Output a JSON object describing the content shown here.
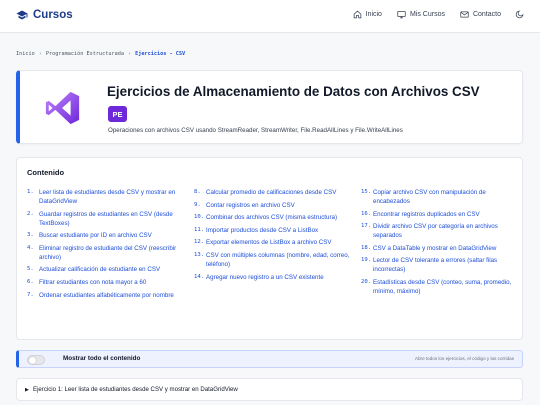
{
  "header": {
    "brand": "Cursos",
    "nav": [
      {
        "label": "Inicio",
        "icon": "home-icon"
      },
      {
        "label": "Mis Cursos",
        "icon": "monitor-icon"
      },
      {
        "label": "Contacto",
        "icon": "mail-icon"
      }
    ],
    "theme_icon": "moon-icon"
  },
  "breadcrumb": [
    "Inicio",
    "Programación Estructurada",
    "Ejercicios - CSV"
  ],
  "hero": {
    "title": "Ejercicios de Almacenamiento de Datos con Archivos CSV",
    "badge": "PE",
    "subtitle": "Operaciones con archivos CSV usando StreamReader, StreamWriter, File.ReadAllLines y File.WriteAllLines",
    "logo": "visual-studio-logo"
  },
  "contents": {
    "title": "Contenido",
    "columns": [
      [
        {
          "num": "1.",
          "text": "Leer lista de estudiantes desde CSV y mostrar en DataGridView"
        },
        {
          "num": "2.",
          "text": "Guardar registros de estudiantes en CSV (desde TextBoxes)"
        },
        {
          "num": "3.",
          "text": "Buscar estudiante por ID en archivo CSV"
        },
        {
          "num": "4.",
          "text": "Eliminar registro de estudiante del CSV (reescribir archivo)"
        },
        {
          "num": "5.",
          "text": "Actualizar calificación de estudiante en CSV"
        },
        {
          "num": "6.",
          "text": "Filtrar estudiantes con nota mayor a 60"
        },
        {
          "num": "7.",
          "text": "Ordenar estudiantes alfabéticamente por nombre"
        }
      ],
      [
        {
          "num": "8.",
          "text": "Calcular promedio de calificaciones desde CSV"
        },
        {
          "num": "9.",
          "text": "Contar registros en archivo CSV"
        },
        {
          "num": "10.",
          "text": "Combinar dos archivos CSV (misma estructura)"
        },
        {
          "num": "11.",
          "text": "Importar productos desde CSV a ListBox"
        },
        {
          "num": "12.",
          "text": "Exportar elementos de ListBox a archivo CSV"
        },
        {
          "num": "13.",
          "text": "CSV con múltiples columnas (nombre, edad, correo, teléfono)"
        },
        {
          "num": "14.",
          "text": "Agregar nuevo registro a un CSV existente"
        }
      ],
      [
        {
          "num": "15.",
          "text": "Copiar archivo CSV con manipulación de encabezados"
        },
        {
          "num": "16.",
          "text": "Encontrar registros duplicados en CSV"
        },
        {
          "num": "17.",
          "text": "Dividir archivo CSV por categoría en archivos separados"
        },
        {
          "num": "18.",
          "text": "CSV a DataTable y mostrar en DataGridView"
        },
        {
          "num": "19.",
          "text": "Lector de CSV tolerante a errores (saltar filas incorrectas)"
        },
        {
          "num": "20.",
          "text": "Estadísticas desde CSV (conteo, suma, promedio, mínimo, máximo)"
        }
      ]
    ]
  },
  "toggle": {
    "label": "Mostrar todo el contenido",
    "hint": "Abre todos los ejercicios, el código y las corridas",
    "on": false
  },
  "exercise": {
    "label": "Ejercicio 1: Leer lista de estudiantes desde CSV y mostrar en DataGridView"
  },
  "colors": {
    "brand": "#1e3a8a",
    "link": "#1d4ed8",
    "accent": "#2563eb",
    "badge": "#6d28d9"
  }
}
